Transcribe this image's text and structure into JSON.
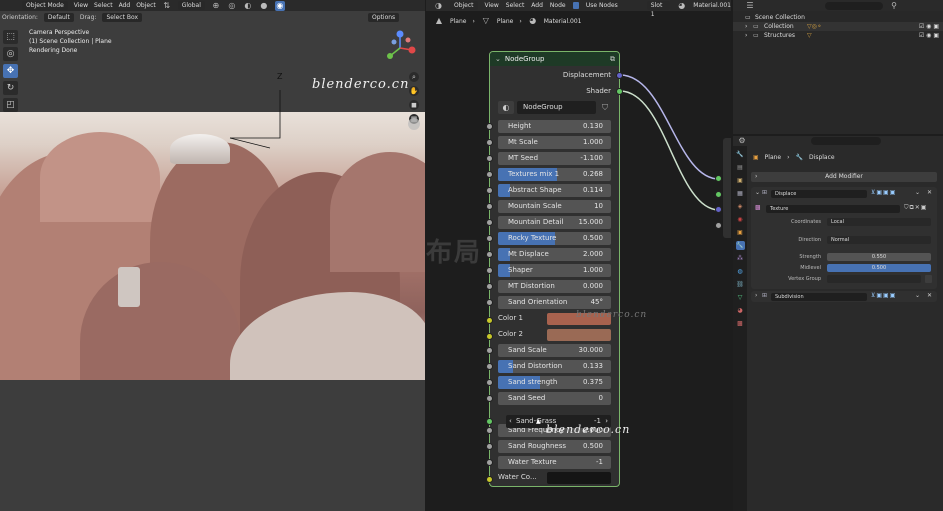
{
  "viewport": {
    "header": {
      "mode": "Object Mode",
      "menus": [
        "View",
        "Select",
        "Add",
        "Object"
      ],
      "transform": "Global"
    },
    "header2": {
      "orientation_label": "Orientation:",
      "orientation_value": "Default",
      "drag_label": "Drag:",
      "drag_value": "Select Box",
      "options": "Options"
    },
    "info": [
      "Camera Perspective",
      "(1) Scene Collection | Plane",
      "Rendering Done"
    ],
    "gizmo_label": "Z",
    "watermark": "blenderco.cn"
  },
  "node_editor": {
    "header": {
      "mode": "Object",
      "menus": [
        "View",
        "Select",
        "Add",
        "Node"
      ],
      "use_nodes": "Use Nodes",
      "slot": "Slot 1",
      "material": "Material.001"
    },
    "breadcrumb": [
      "Plane",
      "Plane",
      "Material.001"
    ],
    "node": {
      "title": "NodeGroup",
      "outputs": [
        "Displacement",
        "Shader"
      ],
      "group_name": "NodeGroup",
      "fields": [
        {
          "label": "Height",
          "value": "0.130",
          "fill": 0
        },
        {
          "label": "Mt Scale",
          "value": "1.000",
          "fill": 0
        },
        {
          "label": "MT Seed",
          "value": "-1.100",
          "fill": 0
        },
        {
          "label": "Textures mix 1",
          "value": "0.268",
          "fill": 0.52
        },
        {
          "label": "Abstract Shape",
          "value": "0.114",
          "fill": 0.11
        },
        {
          "label": "Mountain Scale",
          "value": "10",
          "fill": 0
        },
        {
          "label": "Mountain Detail",
          "value": "15.000",
          "fill": 0
        },
        {
          "label": "Rocky Texture",
          "value": "0.500",
          "fill": 0.5
        },
        {
          "label": "Mt Displace",
          "value": "2.000",
          "fill": 0.11
        },
        {
          "label": "Shaper",
          "value": "1.000",
          "fill": 0.11
        },
        {
          "label": "MT Distortion",
          "value": "0.000",
          "fill": 0
        },
        {
          "label": "Sand Orientation",
          "value": "45°",
          "fill": 0
        },
        {
          "label": "Sand Scale",
          "value": "30.000",
          "fill": 0
        },
        {
          "label": "Sand Distortion",
          "value": "0.133",
          "fill": 0.13
        },
        {
          "label": "Sand strength",
          "value": "0.375",
          "fill": 0.375
        },
        {
          "label": "Sand Seed",
          "value": "0",
          "fill": 0
        },
        {
          "label": "Sand-Grass",
          "value": "-1",
          "fill": 0
        },
        {
          "label": "Sand Frequency",
          "value": "2.000",
          "fill": 0
        },
        {
          "label": "Sand Roughness",
          "value": "0.500",
          "fill": 0
        },
        {
          "label": "Water Texture",
          "value": "-1",
          "fill": 0
        }
      ],
      "color_1": {
        "label": "Color 1",
        "color": "#a8624e"
      },
      "color_2": {
        "label": "Color 2",
        "color": "#9a6a55"
      },
      "water_color": {
        "label": "Water Co...",
        "color": "#151515"
      }
    },
    "watermark_1": "blenderco.cn",
    "watermark_2": "blenderco.cn",
    "overlay_text": "布局"
  },
  "outliner": {
    "search_placeholder": "",
    "rows": [
      "Scene Collection",
      "Collection",
      "Structures"
    ]
  },
  "properties": {
    "breadcrumb": [
      "Plane",
      "Displace"
    ],
    "add_modifier": "Add Modifier",
    "modifier_1": "Displace",
    "texture": "Texture",
    "coordinates_label": "Coordinates",
    "coordinates_value": "Local",
    "direction_label": "Direction",
    "direction_value": "Normal",
    "strength_label": "Strength",
    "strength_value": "0.550",
    "midlevel_label": "Midlevel",
    "midlevel_value": "0.500",
    "vertex_group_label": "Vertex Group",
    "modifier_2": "Subdivision"
  },
  "colors": {
    "accent_blue": "#4772b3",
    "node_border": "#7ab56a",
    "socket_grey": "#a1a1a1",
    "socket_green": "#63c763",
    "socket_yellow": "#c7c729",
    "socket_purple": "#6363c7"
  }
}
